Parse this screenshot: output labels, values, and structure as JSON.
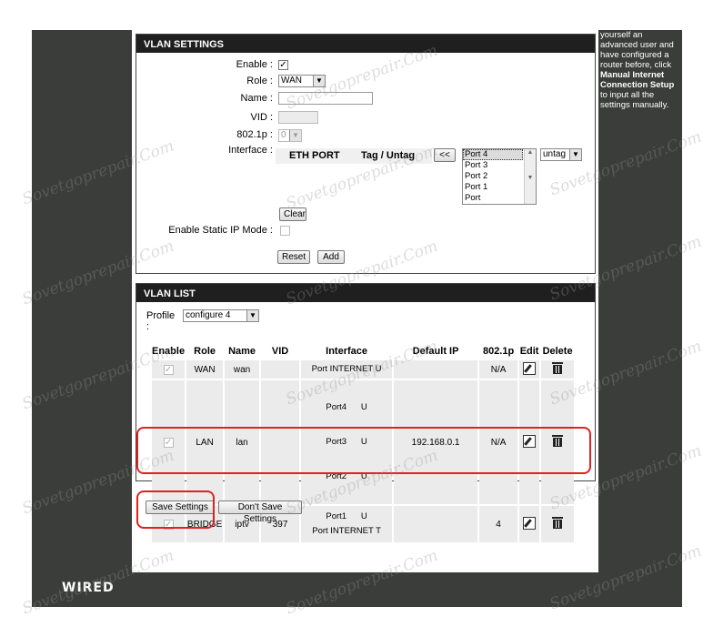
{
  "help_text": {
    "line1": "yourself an",
    "line2": "advanced user and",
    "line3": "have configured a",
    "line4": "router before, click",
    "bold1": "Manual Internet",
    "bold2": "Connection Setup",
    "line5": "to input all the",
    "line6": "settings manually."
  },
  "vlan_settings": {
    "title": "VLAN SETTINGS",
    "enable_label": "Enable :",
    "enable_checked": "✓",
    "role_label": "Role :",
    "role_value": "WAN",
    "name_label": "Name :",
    "name_value": "",
    "vid_label": "VID :",
    "vid_value": "",
    "p8021_label": "802.1p :",
    "p8021_value": "0",
    "interface_label": "Interface :",
    "col_eth_port": "ETH PORT",
    "col_tag_untag": "Tag / Untag",
    "move_button": "<<",
    "ports": [
      "Port 4",
      "Port 3",
      "Port 2",
      "Port 1",
      "Port INTERNET"
    ],
    "tag_value": "untag",
    "clear_button": "Clear",
    "static_ip_label": "Enable Static IP Mode :",
    "reset_button": "Reset",
    "add_button": "Add"
  },
  "vlan_list": {
    "title": "VLAN LIST",
    "profile_label": "Profile :",
    "profile_value": "configure 4",
    "headers": [
      "Enable",
      "Role",
      "Name",
      "VID",
      "Interface",
      "Default IP",
      "802.1p",
      "Edit",
      "Delete"
    ],
    "rows": [
      {
        "enable": "✓",
        "role": "WAN",
        "name": "wan",
        "vid": "",
        "interfaces": [
          "Port INTERNET U"
        ],
        "ip": "",
        "p8021": "N/A"
      },
      {
        "enable": "✓",
        "role": "LAN",
        "name": "lan",
        "vid": "",
        "interfaces": [
          "Port4      U",
          "Port3      U",
          "Port2      U"
        ],
        "ip": "192.168.0.1",
        "p8021": "N/A"
      },
      {
        "enable": "✓",
        "role": "BRIDGE",
        "name": "iptv",
        "vid": "397",
        "interfaces": [
          "Port1      U",
          "Port INTERNET T"
        ],
        "ip": "",
        "p8021": "4"
      }
    ]
  },
  "footer": {
    "save_button": "Save Settings",
    "dont_save_button": "Don't Save Settings",
    "brand": "WIRED"
  },
  "watermark_text": "Sovetgoprepair.Com",
  "colors": {
    "accent_red": "#dd2222",
    "header_dark": "#1f1f1f",
    "frame_dark": "#3a3d3a"
  }
}
